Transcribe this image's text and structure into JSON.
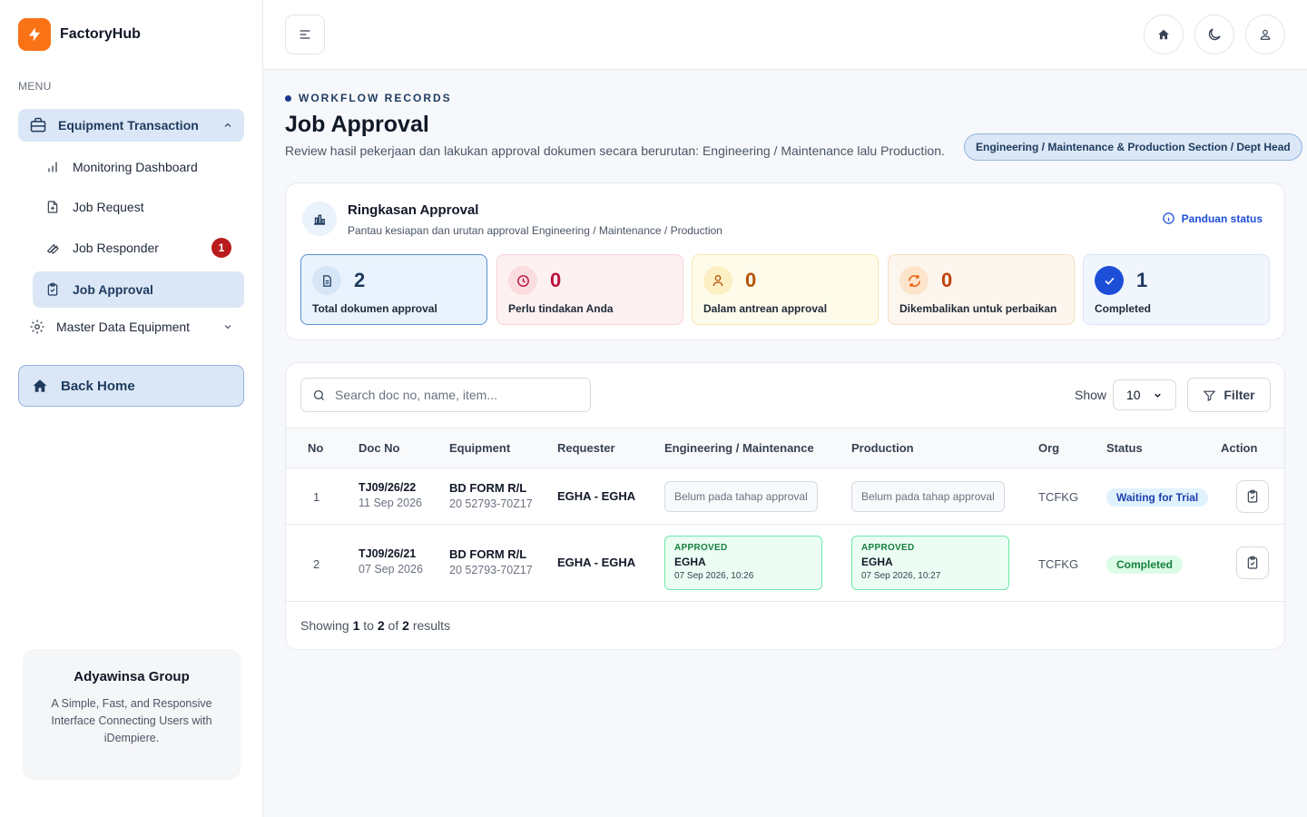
{
  "app": {
    "name": "FactoryHub"
  },
  "sidebar": {
    "menu_label": "MENU",
    "group": {
      "label": "Equipment Transaction"
    },
    "items": [
      {
        "label": "Monitoring Dashboard"
      },
      {
        "label": "Job Request"
      },
      {
        "label": "Job Responder",
        "badge": "1"
      },
      {
        "label": "Job Approval"
      }
    ],
    "master": {
      "label": "Master Data Equipment"
    },
    "back_home": "Back Home",
    "org_card": {
      "title": "Adyawinsa Group",
      "description": "A Simple, Fast, and Responsive Interface Connecting Users with iDempiere."
    }
  },
  "header": {
    "eyebrow": "WORKFLOW RECORDS",
    "title": "Job Approval",
    "description": "Review hasil pekerjaan dan lakukan approval dokumen secara berurutan: Engineering / Maintenance lalu Production.",
    "role": "Engineering / Maintenance & Production Section / Dept Head"
  },
  "summary": {
    "title": "Ringkasan Approval",
    "subtitle": "Pantau kesiapan dan urutan approval Engineering / Maintenance / Production",
    "guide": "Panduan status",
    "stats": [
      {
        "value": "2",
        "label": "Total dokumen approval",
        "icon": "document-icon"
      },
      {
        "value": "0",
        "label": "Perlu tindakan Anda",
        "icon": "clock-icon"
      },
      {
        "value": "0",
        "label": "Dalam antrean approval",
        "icon": "user-icon"
      },
      {
        "value": "0",
        "label": "Dikembalikan untuk perbaikan",
        "icon": "refresh-icon"
      },
      {
        "value": "1",
        "label": "Completed",
        "icon": "check-icon"
      }
    ]
  },
  "table": {
    "search_placeholder": "Search doc no, name, item...",
    "show_label": "Show",
    "page_size": "10",
    "filter_label": "Filter",
    "columns": [
      "No",
      "Doc No",
      "Equipment",
      "Requester",
      "Engineering / Maintenance",
      "Production",
      "Org",
      "Status",
      "Action"
    ],
    "rows": [
      {
        "no": "1",
        "doc_no": "TJ09/26/22",
        "doc_date": "11 Sep 2026",
        "equipment": "BD FORM R/L",
        "equipment_code": "20 52793-70Z17",
        "requester": "EGHA - EGHA",
        "engineering": "Belum pada tahap approval",
        "production": "Belum pada tahap approval",
        "org": "TCFKG",
        "status": "Waiting for Trial"
      },
      {
        "no": "2",
        "doc_no": "TJ09/26/21",
        "doc_date": "07 Sep 2026",
        "equipment": "BD FORM R/L",
        "equipment_code": "20 52793-70Z17",
        "requester": "EGHA - EGHA",
        "engineering": {
          "label": "APPROVED",
          "name": "EGHA",
          "date": "07 Sep 2026, 10:26"
        },
        "production": {
          "label": "APPROVED",
          "name": "EGHA",
          "date": "07 Sep 2026, 10:27"
        },
        "org": "TCFKG",
        "status": "Completed"
      }
    ],
    "footer": {
      "prefix": "Showing",
      "from": "1",
      "to_word": "to",
      "to": "2",
      "of_word": "of",
      "total": "2",
      "suffix": "results"
    }
  },
  "colors": {
    "accent": "#f97316",
    "primary": "#1e3a5f",
    "danger": "#b91c1c",
    "success": "#15803d"
  }
}
